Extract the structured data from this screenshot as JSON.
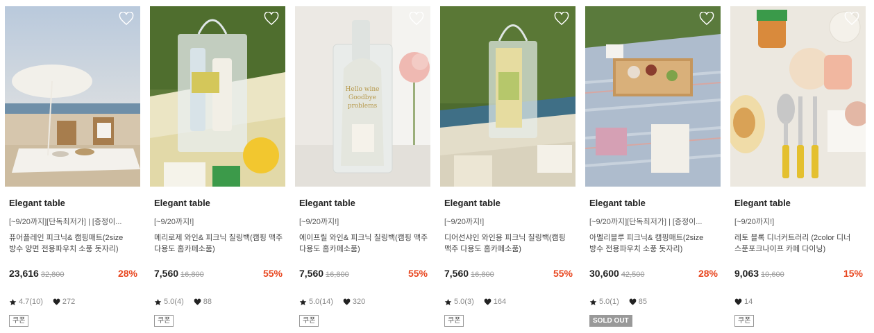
{
  "products": [
    {
      "brand": "Elegant table",
      "subtitle": "[~9/20까지][단독최저가] | [증정이...",
      "name": "퓨어플레인 피크닉& 캠핑매트(2size 방수 양면 전용파우치 소풍 돗자리)",
      "price": "23,616",
      "original_price": "32,800",
      "discount": "28%",
      "rating": "4.7(10)",
      "likes": "272",
      "badge": "쿠폰",
      "image": "beach-umbrella-picnic-mat"
    },
    {
      "brand": "Elegant table",
      "subtitle": "[~9/20까지!]",
      "name": "메리로제 와인& 피크닉 칠링백(캠핑 맥주 다용도 홈카페소품)",
      "price": "7,560",
      "original_price": "16,800",
      "discount": "55%",
      "rating": "5.0(4)",
      "likes": "88",
      "badge": "쿠폰",
      "image": "clear-chilling-bag-with-bottles"
    },
    {
      "brand": "Elegant table",
      "subtitle": "[~9/20까지!]",
      "name": "에이프릴 와인& 피크닉 칠링백(캠핑 맥주 다용도 홈카페소품)",
      "price": "7,560",
      "original_price": "16,800",
      "discount": "55%",
      "rating": "5.0(14)",
      "likes": "320",
      "badge": "쿠폰",
      "image": "clear-wine-bag-with-flowers"
    },
    {
      "brand": "Elegant table",
      "subtitle": "[~9/20까지!]",
      "name": "디어선샤인 와인용 피크닉 칠링백(캠핑 맥주 다용도 홈카페소품)",
      "price": "7,560",
      "original_price": "16,800",
      "discount": "55%",
      "rating": "5.0(3)",
      "likes": "164",
      "badge": "쿠폰",
      "image": "clear-bag-on-grass"
    },
    {
      "brand": "Elegant table",
      "subtitle": "[~9/20까지][단독최저가] | [증정이...",
      "name": "아멜리블루 피크닉& 캠핑매트(2size 방수 전용파우치 소풍 돗자리)",
      "price": "30,600",
      "original_price": "42,500",
      "discount": "28%",
      "rating": "5.0(1)",
      "likes": "85",
      "badge": "SOLD OUT",
      "image": "striped-blue-picnic-mat-tray"
    },
    {
      "brand": "Elegant table",
      "subtitle": "[~9/20까지!]",
      "name": "레토 블록 디너커트러리 (2color 디너 스푼포크나이프 카페 다이닝)",
      "price": "9,063",
      "original_price": "10,600",
      "discount": "15%",
      "rating": "",
      "likes": "14",
      "badge": "쿠폰",
      "image": "yellow-cutlery-table"
    }
  ],
  "colors": {
    "discount": "#e8461f",
    "badge_border": "#999999",
    "soldout_bg": "#999999"
  },
  "icons": {
    "wishlist": "heart-outline-icon",
    "rating": "star-icon",
    "likes": "heart-icon"
  }
}
